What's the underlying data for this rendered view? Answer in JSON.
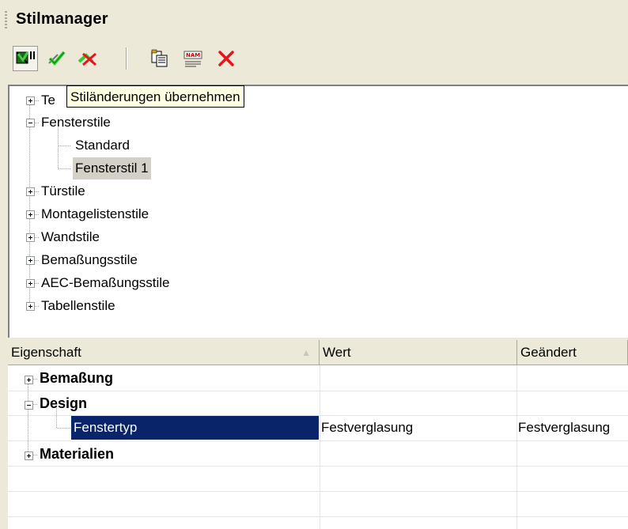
{
  "window": {
    "title": "Stilmanager"
  },
  "toolbar": {
    "buttons": [
      {
        "name": "apply-style-changes-icon"
      },
      {
        "name": "purge-styles-icon"
      },
      {
        "name": "delete-unused-icon"
      },
      {
        "name": "copy-style-icon"
      },
      {
        "name": "rename-style-icon"
      },
      {
        "name": "delete-style-icon"
      }
    ]
  },
  "tooltip": "Stiländerungen übernehmen",
  "tree": {
    "items": [
      {
        "label": "Te",
        "expanded": false
      },
      {
        "label": "Fensterstile",
        "expanded": true,
        "children": [
          {
            "label": "Standard"
          },
          {
            "label": "Fensterstil 1",
            "selected": true
          }
        ]
      },
      {
        "label": "Türstile",
        "expanded": false
      },
      {
        "label": "Montagelistenstile",
        "expanded": false
      },
      {
        "label": "Wandstile",
        "expanded": false
      },
      {
        "label": "Bemaßungsstile",
        "expanded": false
      },
      {
        "label": "AEC-Bemaßungsstile",
        "expanded": false
      },
      {
        "label": "Tabellenstile",
        "expanded": false
      }
    ]
  },
  "grid": {
    "columns": [
      "Eigenschaft",
      "Wert",
      "Geändert"
    ],
    "rows": [
      {
        "label": "Bemaßung",
        "group": true,
        "expanded": false
      },
      {
        "label": "Design",
        "group": true,
        "expanded": true
      },
      {
        "label": "Fenstertyp",
        "value": "Festverglasung",
        "changed": "Festverglasung",
        "selected": true
      },
      {
        "label": "Materialien",
        "group": true,
        "expanded": false
      }
    ]
  },
  "colors": {
    "selection": "#0a246a",
    "tooltip_bg": "#ffffe1",
    "delete_red": "#e8141b"
  }
}
